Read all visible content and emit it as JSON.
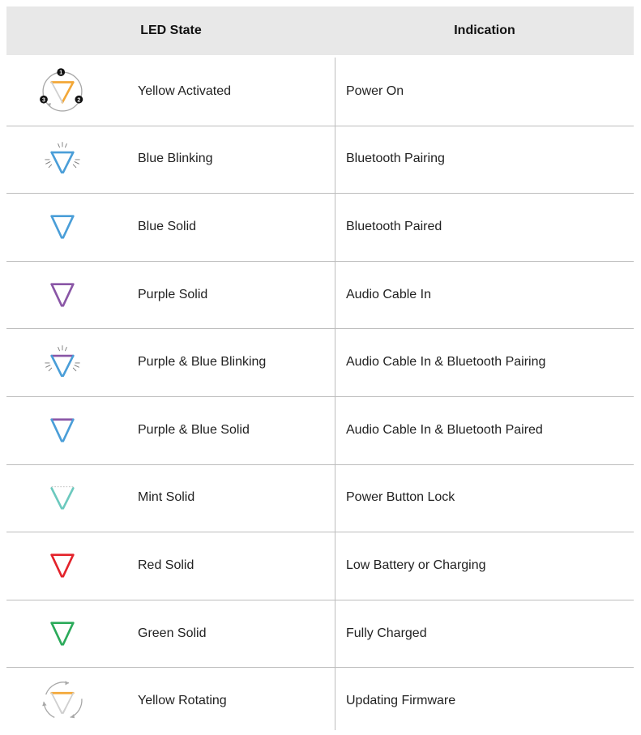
{
  "header": {
    "col_state": "LED State",
    "col_indication": "Indication"
  },
  "rows": [
    {
      "icon": "yellow-activated-sequence-icon",
      "state": "Yellow Activated",
      "indication": "Power On",
      "color": "#F3A838"
    },
    {
      "icon": "blue-blinking-icon",
      "state": "Blue Blinking",
      "indication": "Bluetooth Pairing",
      "color": "#4A9ED8"
    },
    {
      "icon": "blue-solid-icon",
      "state": "Blue Solid",
      "indication": "Bluetooth Paired",
      "color": "#4A9ED8"
    },
    {
      "icon": "purple-solid-icon",
      "state": "Purple Solid",
      "indication": "Audio Cable In",
      "color": "#8A56A6"
    },
    {
      "icon": "purple-blue-blinking-icon",
      "state": "Purple & Blue Blinking",
      "indication": "Audio Cable In & Bluetooth Pairing",
      "color": "#8A56A6"
    },
    {
      "icon": "purple-blue-solid-icon",
      "state": "Purple & Blue Solid",
      "indication": "Audio Cable In & Bluetooth Paired",
      "color": "#8A56A6"
    },
    {
      "icon": "mint-solid-icon",
      "state": "Mint Solid",
      "indication": "Power Button Lock",
      "color": "#6CC9BE"
    },
    {
      "icon": "red-solid-icon",
      "state": "Red Solid",
      "indication": "Low Battery or Charging",
      "color": "#E3232B"
    },
    {
      "icon": "green-solid-icon",
      "state": "Green Solid",
      "indication": "Fully Charged",
      "color": "#2BAA5A"
    },
    {
      "icon": "yellow-rotating-icon",
      "state": "Yellow Rotating",
      "indication": "Updating Firmware",
      "color": "#F3A838"
    }
  ],
  "sequence_numbers": [
    "1",
    "2",
    "3"
  ],
  "colors": {
    "blue": "#4A9ED8",
    "purple": "#8A56A6",
    "gray": "#9a9a9a",
    "header_bg": "#e8e8e8"
  }
}
